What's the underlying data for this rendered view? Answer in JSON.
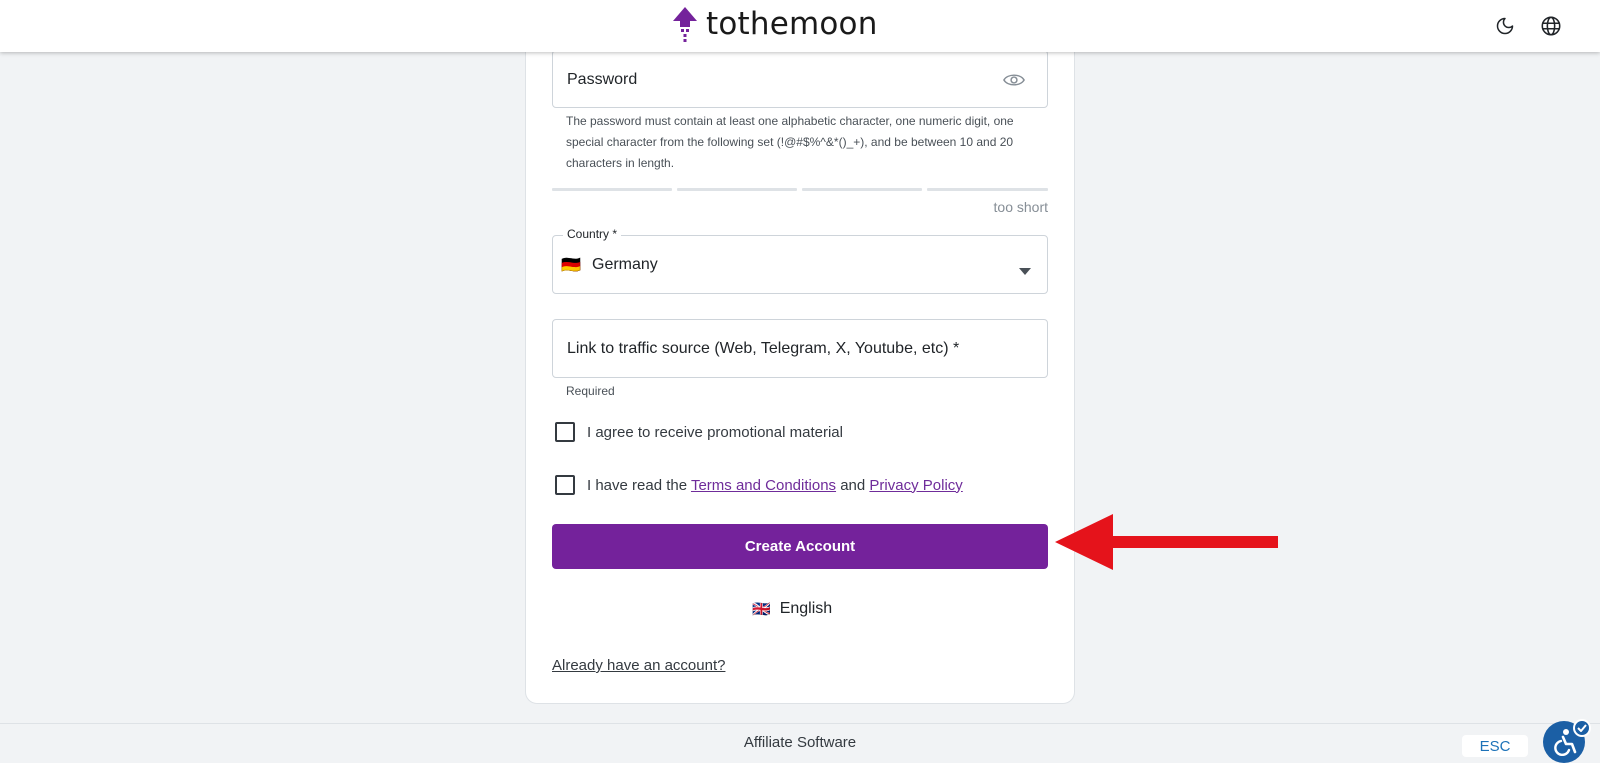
{
  "brand": {
    "name": "tothemoon",
    "accent_color": "#74229b",
    "logo_icon": "rocket-dots-icon"
  },
  "header": {
    "theme_toggle_icon": "moon-icon",
    "language_icon": "globe-icon"
  },
  "form": {
    "password": {
      "label": "Password",
      "visibility_icon": "eye-icon",
      "hint": "The password must contain at least one alphabetic character, one numeric digit, one special character from the following set (!@#$%^&*()_+), and be between 10 and 20 characters in length.",
      "strength_label": "too short"
    },
    "country": {
      "legend": "Country *",
      "value": "Germany",
      "flag": "🇩🇪",
      "dropdown_icon": "caret-down-icon"
    },
    "traffic_source": {
      "label": "Link to traffic source (Web, Telegram, X, Youtube, etc) *",
      "error": "Required"
    },
    "promo_checkbox": {
      "label": "I agree to receive promotional material",
      "checked": false
    },
    "terms_checkbox": {
      "prefix": "I have read the ",
      "terms_link": "Terms and Conditions",
      "conjunction": " and ",
      "privacy_link": "Privacy Policy",
      "checked": false
    },
    "submit_label": "Create Account"
  },
  "language_switch": {
    "flag": "🇬🇧",
    "label": "English"
  },
  "login_link": "Already have an account?",
  "footer": {
    "text": "Affiliate Software"
  },
  "widgets": {
    "esc_label": "ESC",
    "accessibility_icon": "accessibility-icon"
  }
}
